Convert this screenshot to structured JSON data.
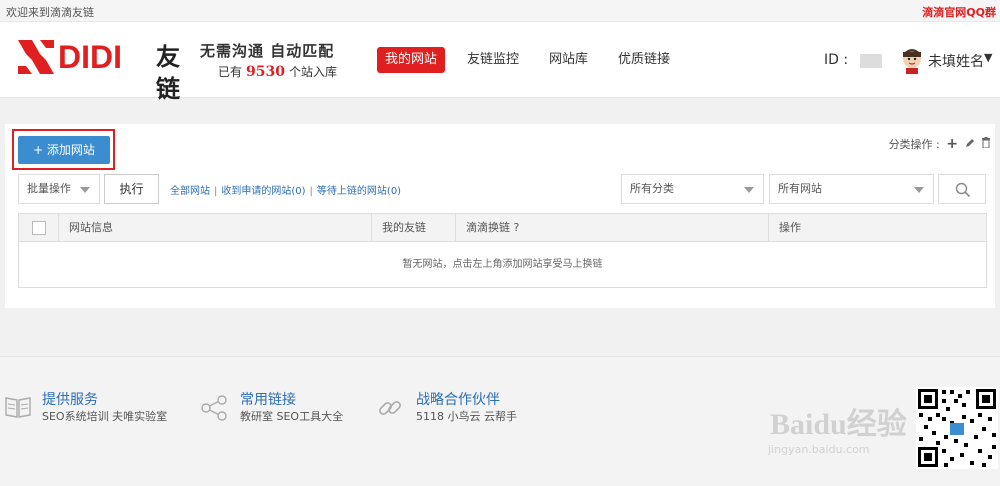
{
  "topbar": {
    "welcome": "欢迎来到滴滴友链",
    "qq_group": "滴滴官网QQ群"
  },
  "logo": {
    "brand": "DIDI",
    "brand_cn": "友链",
    "slogan_line1": "无需沟通 自动匹配",
    "slogan_prefix": "已有",
    "site_count": "9530",
    "slogan_suffix": "个站入库"
  },
  "nav": {
    "items": [
      {
        "label": "我的网站",
        "active": true
      },
      {
        "label": "友链监控",
        "active": false
      },
      {
        "label": "网站库",
        "active": false
      },
      {
        "label": "优质链接",
        "active": false
      }
    ]
  },
  "user": {
    "id_label": "ID :",
    "name": "未填姓名"
  },
  "panel": {
    "add_site": "+ 添加网站",
    "category_ops": "分类操作 :"
  },
  "toolbar": {
    "batch_select": "批量操作",
    "execute": "执行",
    "filter_all": "全部网站",
    "filter_received": "收到申请的网站(0)",
    "filter_waiting": "等待上链的网站(0)",
    "category_select": "所有分类",
    "site_select": "所有网站"
  },
  "table": {
    "headers": [
      "网站信息",
      "我的友链",
      "滴滴换链 ?",
      "操作"
    ],
    "empty_text": "暂无网站，点击左上角添加网站享受马上换链"
  },
  "footer": {
    "columns": [
      {
        "title": "提供服务",
        "links": "SEO系统培训  夫唯实验室",
        "icon": "book-icon"
      },
      {
        "title": "常用链接",
        "links": "教研室  SEO工具大全",
        "icon": "share-icon"
      },
      {
        "title": "战略合作伙伴",
        "links": "5118  小鸟云  云帮手",
        "icon": "link-icon"
      }
    ],
    "watermark_main": "Baidu经验",
    "watermark_url": "jingyan.baidu.com"
  },
  "colors": {
    "brand_red": "#e02020",
    "primary_blue": "#3c8dcf",
    "link_blue": "#2c6fb5"
  }
}
